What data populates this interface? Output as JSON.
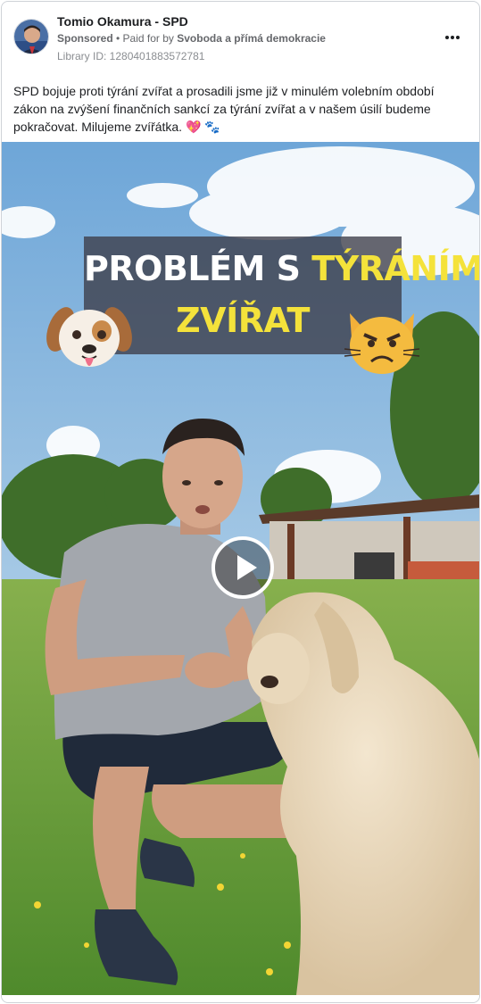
{
  "post": {
    "page_name": "Tomio Okamura - SPD",
    "sponsored_label": "Sponsored",
    "separator": " • ",
    "paid_for_prefix": "Paid for by ",
    "payer": "Svoboda a přímá demokracie",
    "library_id": "Library ID: 1280401883572781",
    "more_icon": "more-horizontal-icon",
    "text": "SPD bojuje proti týrání zvířat a prosadili jsme již v minulém volebním období zákon na zvýšení finančních sankcí za týrání zvířat a v našem úsilí budeme pokračovat. Milujeme zvířátka. 💖 🐾"
  },
  "video": {
    "title_line1_white": "PROBLÉM S ",
    "title_line1_yellow": "TÝRÁNÍM",
    "title_line2": "ZVÍŘAT",
    "emoji_left": "dog-face-emoji",
    "emoji_right": "angry-cat-emoji",
    "play_icon": "play-icon"
  },
  "colors": {
    "title_yellow": "#f4e23b",
    "banner_bg": "#3c3c48",
    "sky": "#7fb0dc",
    "grass": "#6e9e3c"
  }
}
